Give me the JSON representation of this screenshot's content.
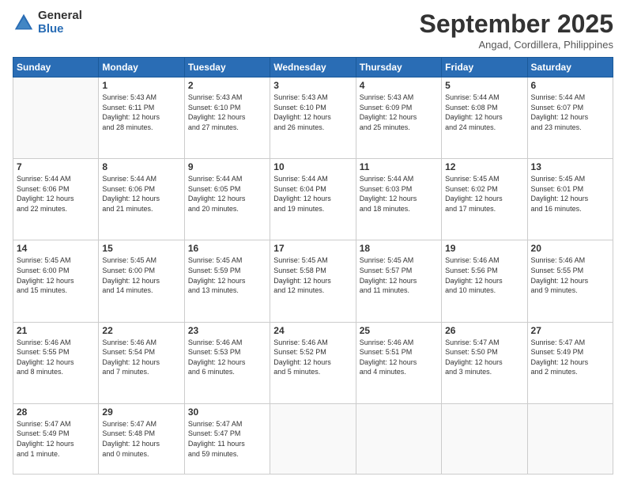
{
  "logo": {
    "general": "General",
    "blue": "Blue"
  },
  "header": {
    "month": "September 2025",
    "location": "Angad, Cordillera, Philippines"
  },
  "days_of_week": [
    "Sunday",
    "Monday",
    "Tuesday",
    "Wednesday",
    "Thursday",
    "Friday",
    "Saturday"
  ],
  "weeks": [
    [
      {
        "day": null,
        "info": null
      },
      {
        "day": "1",
        "info": "Sunrise: 5:43 AM\nSunset: 6:11 PM\nDaylight: 12 hours\nand 28 minutes."
      },
      {
        "day": "2",
        "info": "Sunrise: 5:43 AM\nSunset: 6:10 PM\nDaylight: 12 hours\nand 27 minutes."
      },
      {
        "day": "3",
        "info": "Sunrise: 5:43 AM\nSunset: 6:10 PM\nDaylight: 12 hours\nand 26 minutes."
      },
      {
        "day": "4",
        "info": "Sunrise: 5:43 AM\nSunset: 6:09 PM\nDaylight: 12 hours\nand 25 minutes."
      },
      {
        "day": "5",
        "info": "Sunrise: 5:44 AM\nSunset: 6:08 PM\nDaylight: 12 hours\nand 24 minutes."
      },
      {
        "day": "6",
        "info": "Sunrise: 5:44 AM\nSunset: 6:07 PM\nDaylight: 12 hours\nand 23 minutes."
      }
    ],
    [
      {
        "day": "7",
        "info": "Sunrise: 5:44 AM\nSunset: 6:06 PM\nDaylight: 12 hours\nand 22 minutes."
      },
      {
        "day": "8",
        "info": "Sunrise: 5:44 AM\nSunset: 6:06 PM\nDaylight: 12 hours\nand 21 minutes."
      },
      {
        "day": "9",
        "info": "Sunrise: 5:44 AM\nSunset: 6:05 PM\nDaylight: 12 hours\nand 20 minutes."
      },
      {
        "day": "10",
        "info": "Sunrise: 5:44 AM\nSunset: 6:04 PM\nDaylight: 12 hours\nand 19 minutes."
      },
      {
        "day": "11",
        "info": "Sunrise: 5:44 AM\nSunset: 6:03 PM\nDaylight: 12 hours\nand 18 minutes."
      },
      {
        "day": "12",
        "info": "Sunrise: 5:45 AM\nSunset: 6:02 PM\nDaylight: 12 hours\nand 17 minutes."
      },
      {
        "day": "13",
        "info": "Sunrise: 5:45 AM\nSunset: 6:01 PM\nDaylight: 12 hours\nand 16 minutes."
      }
    ],
    [
      {
        "day": "14",
        "info": "Sunrise: 5:45 AM\nSunset: 6:00 PM\nDaylight: 12 hours\nand 15 minutes."
      },
      {
        "day": "15",
        "info": "Sunrise: 5:45 AM\nSunset: 6:00 PM\nDaylight: 12 hours\nand 14 minutes."
      },
      {
        "day": "16",
        "info": "Sunrise: 5:45 AM\nSunset: 5:59 PM\nDaylight: 12 hours\nand 13 minutes."
      },
      {
        "day": "17",
        "info": "Sunrise: 5:45 AM\nSunset: 5:58 PM\nDaylight: 12 hours\nand 12 minutes."
      },
      {
        "day": "18",
        "info": "Sunrise: 5:45 AM\nSunset: 5:57 PM\nDaylight: 12 hours\nand 11 minutes."
      },
      {
        "day": "19",
        "info": "Sunrise: 5:46 AM\nSunset: 5:56 PM\nDaylight: 12 hours\nand 10 minutes."
      },
      {
        "day": "20",
        "info": "Sunrise: 5:46 AM\nSunset: 5:55 PM\nDaylight: 12 hours\nand 9 minutes."
      }
    ],
    [
      {
        "day": "21",
        "info": "Sunrise: 5:46 AM\nSunset: 5:55 PM\nDaylight: 12 hours\nand 8 minutes."
      },
      {
        "day": "22",
        "info": "Sunrise: 5:46 AM\nSunset: 5:54 PM\nDaylight: 12 hours\nand 7 minutes."
      },
      {
        "day": "23",
        "info": "Sunrise: 5:46 AM\nSunset: 5:53 PM\nDaylight: 12 hours\nand 6 minutes."
      },
      {
        "day": "24",
        "info": "Sunrise: 5:46 AM\nSunset: 5:52 PM\nDaylight: 12 hours\nand 5 minutes."
      },
      {
        "day": "25",
        "info": "Sunrise: 5:46 AM\nSunset: 5:51 PM\nDaylight: 12 hours\nand 4 minutes."
      },
      {
        "day": "26",
        "info": "Sunrise: 5:47 AM\nSunset: 5:50 PM\nDaylight: 12 hours\nand 3 minutes."
      },
      {
        "day": "27",
        "info": "Sunrise: 5:47 AM\nSunset: 5:49 PM\nDaylight: 12 hours\nand 2 minutes."
      }
    ],
    [
      {
        "day": "28",
        "info": "Sunrise: 5:47 AM\nSunset: 5:49 PM\nDaylight: 12 hours\nand 1 minute."
      },
      {
        "day": "29",
        "info": "Sunrise: 5:47 AM\nSunset: 5:48 PM\nDaylight: 12 hours\nand 0 minutes."
      },
      {
        "day": "30",
        "info": "Sunrise: 5:47 AM\nSunset: 5:47 PM\nDaylight: 11 hours\nand 59 minutes."
      },
      {
        "day": null,
        "info": null
      },
      {
        "day": null,
        "info": null
      },
      {
        "day": null,
        "info": null
      },
      {
        "day": null,
        "info": null
      }
    ]
  ]
}
